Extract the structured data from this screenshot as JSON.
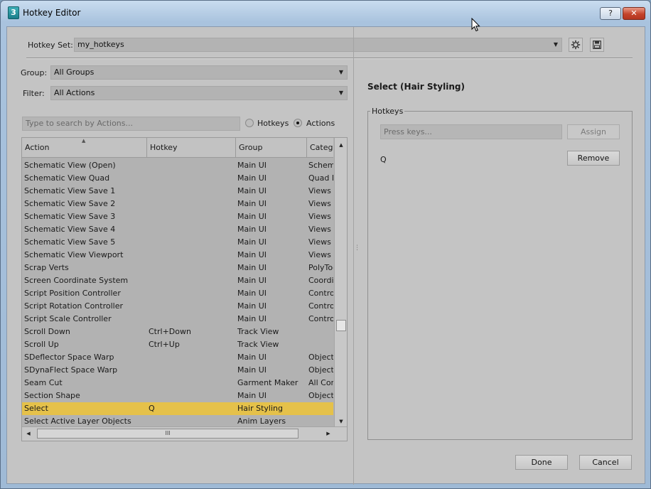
{
  "window": {
    "title": "Hotkey Editor",
    "app_icon_glyph": "3",
    "help_label": "?",
    "close_label": "✕"
  },
  "hotkey_set": {
    "label": "Hotkey Set:",
    "value": "my_hotkeys",
    "gear_icon": "gear-icon",
    "save_icon": "save-icon"
  },
  "group": {
    "label": "Group:",
    "value": "All Groups"
  },
  "filter": {
    "label": "Filter:",
    "value": "All Actions"
  },
  "search": {
    "placeholder": "Type to search by Actions..."
  },
  "search_mode": {
    "hotkeys_label": "Hotkeys",
    "actions_label": "Actions",
    "selected": "Actions"
  },
  "table": {
    "columns": [
      "Action",
      "Hotkey",
      "Group",
      "Catego"
    ],
    "rows": [
      {
        "action": "Schematic View (Open)",
        "hotkey": "",
        "group": "Main UI",
        "category": "Schema"
      },
      {
        "action": "Schematic View Quad",
        "hotkey": "",
        "group": "Main UI",
        "category": "Quad M"
      },
      {
        "action": "Schematic View Save 1",
        "hotkey": "",
        "group": "Main UI",
        "category": "Views"
      },
      {
        "action": "Schematic View Save 2",
        "hotkey": "",
        "group": "Main UI",
        "category": "Views"
      },
      {
        "action": "Schematic View Save 3",
        "hotkey": "",
        "group": "Main UI",
        "category": "Views"
      },
      {
        "action": "Schematic View Save 4",
        "hotkey": "",
        "group": "Main UI",
        "category": "Views"
      },
      {
        "action": "Schematic View Save 5",
        "hotkey": "",
        "group": "Main UI",
        "category": "Views"
      },
      {
        "action": "Schematic View Viewport",
        "hotkey": "",
        "group": "Main UI",
        "category": "Views"
      },
      {
        "action": "Scrap Verts",
        "hotkey": "",
        "group": "Main UI",
        "category": "PolyToo"
      },
      {
        "action": "Screen Coordinate System",
        "hotkey": "",
        "group": "Main UI",
        "category": "Coordin"
      },
      {
        "action": "Script Position Controller",
        "hotkey": "",
        "group": "Main UI",
        "category": "Control"
      },
      {
        "action": "Script Rotation Controller",
        "hotkey": "",
        "group": "Main UI",
        "category": "Control"
      },
      {
        "action": "Script Scale Controller",
        "hotkey": "",
        "group": "Main UI",
        "category": "Control"
      },
      {
        "action": "Scroll Down",
        "hotkey": "Ctrl+Down",
        "group": "Track View",
        "category": ""
      },
      {
        "action": "Scroll Up",
        "hotkey": "Ctrl+Up",
        "group": "Track View",
        "category": ""
      },
      {
        "action": "SDeflector Space Warp",
        "hotkey": "",
        "group": "Main UI",
        "category": "Objects"
      },
      {
        "action": "SDynaFlect Space Warp",
        "hotkey": "",
        "group": "Main UI",
        "category": "Objects"
      },
      {
        "action": "Seam Cut",
        "hotkey": "",
        "group": "Garment Maker",
        "category": "All Com"
      },
      {
        "action": "Section Shape",
        "hotkey": "",
        "group": "Main UI",
        "category": "Objects"
      },
      {
        "action": "Select",
        "hotkey": "Q",
        "group": "Hair Styling",
        "category": "",
        "selected": true
      },
      {
        "action": "Select Active Layer Objects",
        "hotkey": "",
        "group": "Anim Layers",
        "category": ""
      }
    ]
  },
  "scroll": {
    "hthumb_grip": "III"
  },
  "detail": {
    "title": "Select (Hair Styling)",
    "hotkeys_group_label": "Hotkeys",
    "press_keys_placeholder": "Press keys...",
    "assign_label": "Assign",
    "current_hotkey": "Q",
    "remove_label": "Remove"
  },
  "footer": {
    "done_label": "Done",
    "cancel_label": "Cancel"
  }
}
